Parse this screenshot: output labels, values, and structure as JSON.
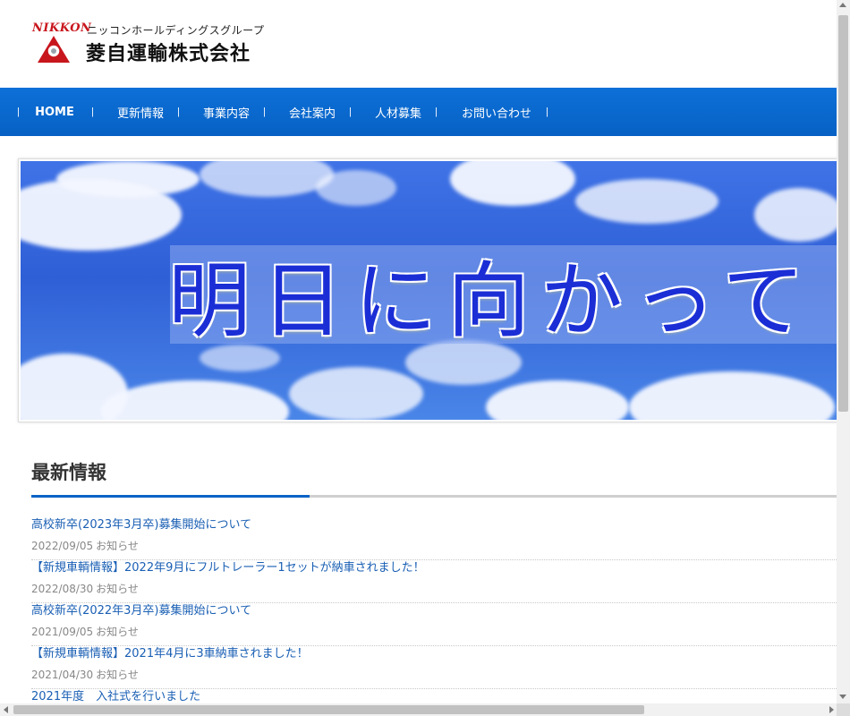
{
  "logo": {
    "nikkon": "NIKKON",
    "group": "ニッコンホールディングスグループ",
    "company": "菱自運輸株式会社",
    "mark_color": "#c8161d"
  },
  "nav": {
    "items": [
      {
        "label": "HOME"
      },
      {
        "label": "更新情報"
      },
      {
        "label": "事業内容"
      },
      {
        "label": "会社案内"
      },
      {
        "label": "人材募集"
      },
      {
        "label": "お問い合わせ"
      }
    ],
    "separator": "|",
    "color": "#0a6ad0"
  },
  "hero": {
    "text": "明日に向かって"
  },
  "news": {
    "title": "最新情報",
    "accent_color": "#0a63c6",
    "items": [
      {
        "title": "高校新卒(2023年3月卒)募集開始について",
        "date": "2022/09/05",
        "category": "お知らせ"
      },
      {
        "title": "【新規車輌情報】2022年9月にフルトレーラー1セットが納車されました！",
        "date": "2022/08/30",
        "category": "お知らせ"
      },
      {
        "title": "高校新卒(2022年3月卒)募集開始について",
        "date": "2021/09/05",
        "category": "お知らせ"
      },
      {
        "title": "【新規車輌情報】2021年4月に3車納車されました！",
        "date": "2021/04/30",
        "category": "お知らせ"
      },
      {
        "title": "2021年度　入社式を行いました",
        "date": "",
        "category": ""
      }
    ]
  }
}
